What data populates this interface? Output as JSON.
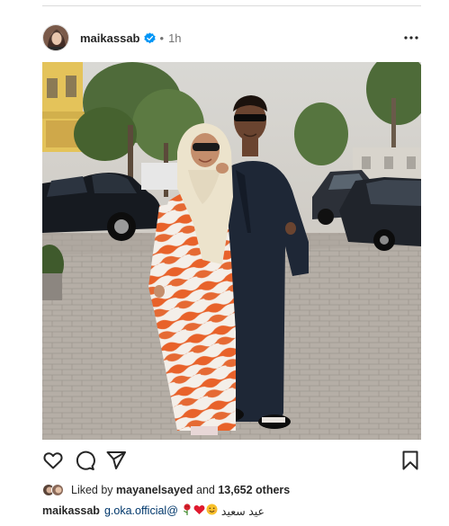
{
  "post": {
    "username": "maikassab",
    "separator": "•",
    "time_ago": "1h",
    "verified": true
  },
  "photo": {
    "alt": "Woman in orange and white zebra-pattern dress and cream hijab with sunglasses, beside a man in a dark navy jalabiya with sunglasses, in a paved parking area"
  },
  "actions": {
    "icons": [
      "heart-icon",
      "comment-icon",
      "share-icon",
      "bookmark-icon"
    ]
  },
  "likes": {
    "prefix": "Liked by ",
    "first_liker": "mayanelsayed",
    "middle": " and ",
    "others_count": "13,652 others"
  },
  "caption": {
    "username": "maikassab",
    "mention": "g.oka.official@",
    "emojis": [
      "rose-emoji",
      "red-heart-emoji",
      "smiling-face-emoji"
    ],
    "text": "عيد سعيد"
  },
  "colors": {
    "accent_link": "#00376b",
    "verified_blue": "#0095f6",
    "secondary_text": "#737373"
  }
}
